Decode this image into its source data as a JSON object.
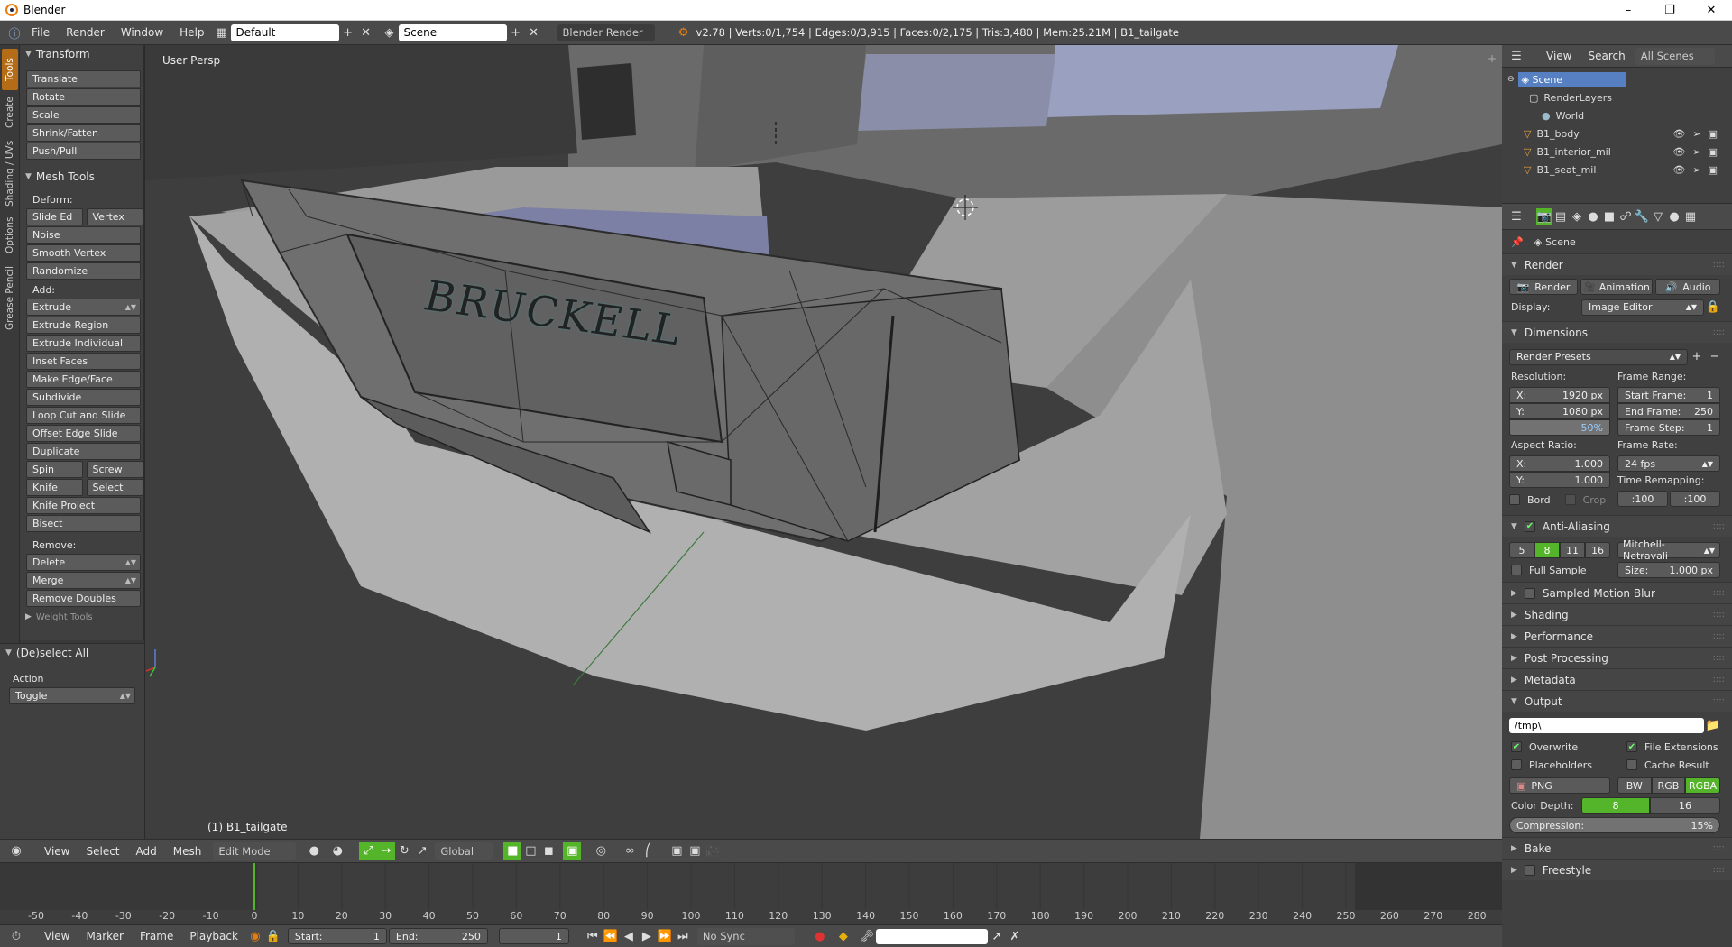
{
  "window": {
    "title": "Blender"
  },
  "menubar": {
    "menus": [
      "File",
      "Render",
      "Window",
      "Help"
    ],
    "layout": "Default",
    "scene": "Scene",
    "engine": "Blender Render",
    "stats": "v2.78 | Verts:0/1,754 | Edges:0/3,915 | Faces:0/2,175 | Tris:3,480 | Mem:25.21M | B1_tailgate"
  },
  "tabs": [
    "Tools",
    "Create",
    "Shading / UVs",
    "Options",
    "Grease Pencil"
  ],
  "toolshelf": {
    "transform_title": "Transform",
    "transform": [
      "Translate",
      "Rotate",
      "Scale",
      "Shrink/Fatten",
      "Push/Pull"
    ],
    "meshtools_title": "Mesh Tools",
    "deform_label": "Deform:",
    "slide_edge": "Slide Ed",
    "vertex": "Vertex",
    "deform": [
      "Noise",
      "Smooth Vertex",
      "Randomize"
    ],
    "add_label": "Add:",
    "add": [
      "Extrude",
      "Extrude Region",
      "Extrude Individual",
      "Inset Faces",
      "Make Edge/Face",
      "Subdivide",
      "Loop Cut and Slide",
      "Offset Edge Slide",
      "Duplicate"
    ],
    "spin": "Spin",
    "screw": "Screw",
    "knife": "Knife",
    "select": "Select",
    "knife_project": "Knife Project",
    "bisect": "Bisect",
    "remove_label": "Remove:",
    "remove": [
      "Delete",
      "Merge",
      "Remove Doubles"
    ],
    "weight_tools": "Weight Tools"
  },
  "operator": {
    "title": "(De)select All",
    "action_label": "Action",
    "action_value": "Toggle"
  },
  "viewport": {
    "view_label": "User Persp",
    "object_label": "(1) B1_tailgate",
    "logo_text": "BRUCKELL"
  },
  "v3dheader": {
    "menus": [
      "View",
      "Select",
      "Add",
      "Mesh"
    ],
    "mode": "Edit Mode",
    "orientation": "Global"
  },
  "timeline": {
    "ticks": [
      "-50",
      "-40",
      "-30",
      "-20",
      "-10",
      "0",
      "10",
      "20",
      "30",
      "40",
      "50",
      "60",
      "70",
      "80",
      "90",
      "100",
      "110",
      "120",
      "130",
      "140",
      "150",
      "160",
      "170",
      "180",
      "190",
      "200",
      "210",
      "220",
      "230",
      "240",
      "250",
      "260",
      "270",
      "280"
    ],
    "current_frame": 0
  },
  "tlheader": {
    "menus": [
      "View",
      "Marker",
      "Frame",
      "Playback"
    ],
    "start_label": "Start:",
    "start_value": "1",
    "end_label": "End:",
    "end_value": "250",
    "current": "1",
    "sync": "No Sync"
  },
  "outliner": {
    "menus": [
      "View",
      "Search"
    ],
    "filter": "All Scenes",
    "items": [
      "Scene",
      "RenderLayers",
      "World",
      "B1_body",
      "B1_interior_mil",
      "B1_seat_mil"
    ]
  },
  "props": {
    "context": "Scene",
    "render_title": "Render",
    "render_btn": "Render",
    "animation_btn": "Animation",
    "audio_btn": "Audio",
    "display_label": "Display:",
    "display_value": "Image Editor",
    "dimensions_title": "Dimensions",
    "render_presets": "Render Presets",
    "resolution_label": "Resolution:",
    "res_x_label": "X:",
    "res_x": "1920 px",
    "res_y_label": "Y:",
    "res_y": "1080 px",
    "res_pct": "50%",
    "frame_range_label": "Frame Range:",
    "start_frame_label": "Start Frame:",
    "start_frame": "1",
    "end_frame_label": "End Frame:",
    "end_frame": "250",
    "frame_step_label": "Frame Step:",
    "frame_step": "1",
    "aspect_label": "Aspect Ratio:",
    "asp_x": "1.000",
    "asp_y": "1.000",
    "frame_rate_label": "Frame Rate:",
    "frame_rate": "24 fps",
    "time_remap_label": "Time Remapping:",
    "remap_old": ":100",
    "remap_new": ":100",
    "bord": "Bord",
    "crop": "Crop",
    "aa_title": "Anti-Aliasing",
    "aa_samples": [
      "5",
      "8",
      "11",
      "16"
    ],
    "aa_filter": "Mitchell-Netravali",
    "full_sample": "Full Sample",
    "size_label": "Size:",
    "size_value": "1.000 px",
    "collapsed": [
      "Sampled Motion Blur",
      "Shading",
      "Performance",
      "Post Processing",
      "Metadata"
    ],
    "output_title": "Output",
    "output_path": "/tmp\\",
    "overwrite": "Overwrite",
    "file_ext": "File Extensions",
    "placeholders": "Placeholders",
    "cache_result": "Cache Result",
    "format": "PNG",
    "bw": "BW",
    "rgb": "RGB",
    "rgba": "RGBA",
    "color_depth_label": "Color Depth:",
    "depth8": "8",
    "depth16": "16",
    "compression_label": "Compression:",
    "compression": "15%",
    "bake": "Bake",
    "freestyle": "Freestyle"
  },
  "colors": {
    "accent": "#55b52a",
    "selected": "#5680c2",
    "orange": "#e87d0d"
  }
}
